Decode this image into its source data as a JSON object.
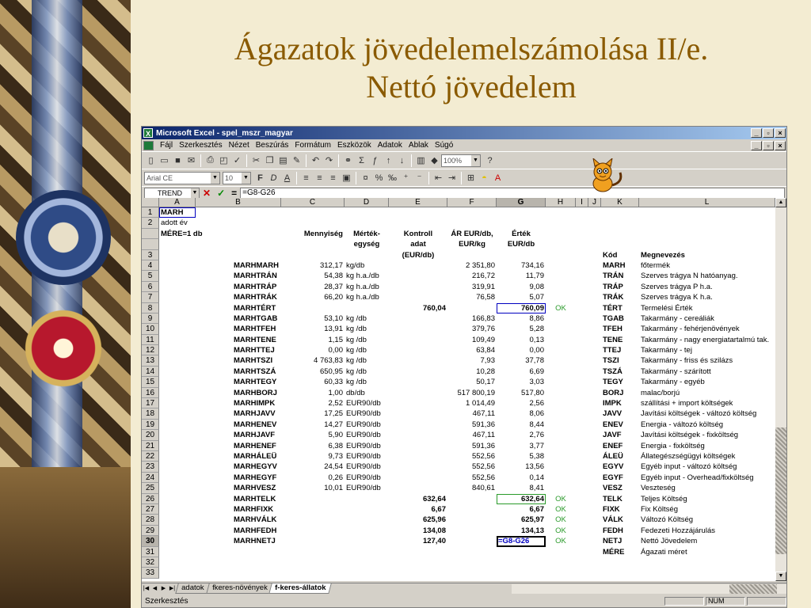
{
  "slide": {
    "title_line1": "Ágazatok jövedelemelszámolása II/e.",
    "title_line2": "Nettó jövedelem"
  },
  "window": {
    "title": "Microsoft Excel - spel_mszr_magyar",
    "controls": [
      "_",
      "▫",
      "×"
    ]
  },
  "menu": [
    "Fájl",
    "Szerkesztés",
    "Nézet",
    "Beszúrás",
    "Formátum",
    "Eszközök",
    "Adatok",
    "Ablak",
    "Súgó"
  ],
  "toolbar": {
    "zoom": "100%",
    "font_name": "Arial CE",
    "font_size": "10",
    "bold": "F",
    "italic": "D",
    "underline": "A"
  },
  "formula_bar": {
    "name_box": "TREND",
    "equals": "=",
    "formula": "=G8-G26"
  },
  "columns": [
    "A",
    "B",
    "C",
    "D",
    "E",
    "F",
    "G",
    "H",
    "I",
    "J",
    "K",
    "L"
  ],
  "rows": [
    {
      "n": "1",
      "a": "MARH",
      "b": "",
      "c": "",
      "d": "",
      "e": "",
      "f": "",
      "g": "",
      "h": "",
      "k": "",
      "l": ""
    },
    {
      "n": "2",
      "a": "adott év",
      "b": "",
      "c": "",
      "d": "",
      "e": "",
      "f": "",
      "g": "",
      "h": "",
      "k": "",
      "l": ""
    },
    {
      "n": "",
      "a": "MÉRE=1 db",
      "b": "",
      "c": "Mennyiség",
      "d": "Mérték-",
      "e": "Kontroll",
      "f": "ÁR EUR/db,",
      "g": "Érték",
      "h": "",
      "k": "",
      "l": ""
    },
    {
      "n": "",
      "a": "",
      "b": "",
      "c": "",
      "d": "egység",
      "e": "adat",
      "f": "EUR/kg",
      "g": "EUR/db",
      "h": "",
      "k": "",
      "l": ""
    },
    {
      "n": "3",
      "a": "",
      "b": "",
      "c": "",
      "d": "",
      "e": "(EUR/db)",
      "f": "",
      "g": "",
      "h": "",
      "k": "Kód",
      "l": "Megnevezés"
    },
    {
      "n": "4",
      "a": "",
      "b": "MARHMARH",
      "c": "312,17",
      "d": "kg/db",
      "e": "",
      "f": "2 351,80",
      "g": "734,16",
      "h": "",
      "k": "MARH",
      "l": "főtermék"
    },
    {
      "n": "5",
      "a": "",
      "b": "MARHTRÁN",
      "c": "54,38",
      "d": "kg h.a./db",
      "e": "",
      "f": "216,72",
      "g": "11,79",
      "h": "",
      "k": "TRÁN",
      "l": "Szerves trágya N hatóanyag."
    },
    {
      "n": "6",
      "a": "",
      "b": "MARHTRÁP",
      "c": "28,37",
      "d": "kg h.a./db",
      "e": "",
      "f": "319,91",
      "g": "9,08",
      "h": "",
      "k": "TRÁP",
      "l": "Szerves trágya P h.a."
    },
    {
      "n": "7",
      "a": "",
      "b": "MARHTRÁK",
      "c": "66,20",
      "d": "kg h.a./db",
      "e": "",
      "f": "76,58",
      "g": "5,07",
      "h": "",
      "k": "TRÁK",
      "l": "Szerves trágya K h.a."
    },
    {
      "n": "8",
      "a": "",
      "b": "MARHTÉRT",
      "c": "",
      "d": "",
      "e": "760,04",
      "f": "",
      "g": "760,09",
      "h": "OK",
      "k": "TÉRT",
      "l": "Termelési Érték"
    },
    {
      "n": "9",
      "a": "",
      "b": "MARHTGAB",
      "c": "53,10",
      "d": "kg /db",
      "e": "",
      "f": "166,83",
      "g": "8,86",
      "h": "",
      "k": "TGAB",
      "l": "Takarmány - cereáliák"
    },
    {
      "n": "10",
      "a": "",
      "b": "MARHTFEH",
      "c": "13,91",
      "d": "kg /db",
      "e": "",
      "f": "379,76",
      "g": "5,28",
      "h": "",
      "k": "TFEH",
      "l": "Takarmány - fehérjenövények"
    },
    {
      "n": "11",
      "a": "",
      "b": "MARHTENE",
      "c": "1,15",
      "d": "kg /db",
      "e": "",
      "f": "109,49",
      "g": "0,13",
      "h": "",
      "k": "TENE",
      "l": "Takarmány - nagy energiatartalmú tak."
    },
    {
      "n": "12",
      "a": "",
      "b": "MARHTTEJ",
      "c": "0,00",
      "d": "kg /db",
      "e": "",
      "f": "63,84",
      "g": "0,00",
      "h": "",
      "k": "TTEJ",
      "l": "Takarmány - tej"
    },
    {
      "n": "13",
      "a": "",
      "b": "MARHTSZI",
      "c": "4 763,83",
      "d": "kg /db",
      "e": "",
      "f": "7,93",
      "g": "37,78",
      "h": "",
      "k": "TSZI",
      "l": "Takarmány - friss és szilázs"
    },
    {
      "n": "14",
      "a": "",
      "b": "MARHTSZÁ",
      "c": "650,95",
      "d": "kg /db",
      "e": "",
      "f": "10,28",
      "g": "6,69",
      "h": "",
      "k": "TSZÁ",
      "l": "Takarmány - szárított"
    },
    {
      "n": "15",
      "a": "",
      "b": "MARHTEGY",
      "c": "60,33",
      "d": "kg /db",
      "e": "",
      "f": "50,17",
      "g": "3,03",
      "h": "",
      "k": "TEGY",
      "l": "Takarmány - egyéb"
    },
    {
      "n": "16",
      "a": "",
      "b": "MARHBORJ",
      "c": "1,00",
      "d": "db/db",
      "e": "",
      "f": "517 800,19",
      "g": "517,80",
      "h": "",
      "k": "BORJ",
      "l": "malac/borjú"
    },
    {
      "n": "17",
      "a": "",
      "b": "MARHIMPK",
      "c": "2,52",
      "d": "EUR90/db",
      "e": "",
      "f": "1 014,49",
      "g": "2,56",
      "h": "",
      "k": "IMPK",
      "l": "szállítási + import költségek"
    },
    {
      "n": "18",
      "a": "",
      "b": "MARHJAVV",
      "c": "17,25",
      "d": "EUR90/db",
      "e": "",
      "f": "467,11",
      "g": "8,06",
      "h": "",
      "k": "JAVV",
      "l": "Javítási költségek - változó költség"
    },
    {
      "n": "19",
      "a": "",
      "b": "MARHENEV",
      "c": "14,27",
      "d": "EUR90/db",
      "e": "",
      "f": "591,36",
      "g": "8,44",
      "h": "",
      "k": "ENEV",
      "l": "Energia - változó költség"
    },
    {
      "n": "20",
      "a": "",
      "b": "MARHJAVF",
      "c": "5,90",
      "d": "EUR90/db",
      "e": "",
      "f": "467,11",
      "g": "2,76",
      "h": "",
      "k": "JAVF",
      "l": "Javítási költségek - fixköltség"
    },
    {
      "n": "21",
      "a": "",
      "b": "MARHENEF",
      "c": "6,38",
      "d": "EUR90/db",
      "e": "",
      "f": "591,36",
      "g": "3,77",
      "h": "",
      "k": "ENEF",
      "l": "Energia - fixköltség"
    },
    {
      "n": "22",
      "a": "",
      "b": "MARHÁLEÜ",
      "c": "9,73",
      "d": "EUR90/db",
      "e": "",
      "f": "552,56",
      "g": "5,38",
      "h": "",
      "k": "ÁLEÜ",
      "l": "Állategészségügyi költségek"
    },
    {
      "n": "23",
      "a": "",
      "b": "MARHEGYV",
      "c": "24,54",
      "d": "EUR90/db",
      "e": "",
      "f": "552,56",
      "g": "13,56",
      "h": "",
      "k": "EGYV",
      "l": "Egyéb input - változó költség"
    },
    {
      "n": "24",
      "a": "",
      "b": "MARHEGYF",
      "c": "0,26",
      "d": "EUR90/db",
      "e": "",
      "f": "552,56",
      "g": "0,14",
      "h": "",
      "k": "EGYF",
      "l": "Egyéb input - Overhead/fixköltség"
    },
    {
      "n": "25",
      "a": "",
      "b": "MARHVESZ",
      "c": "10,01",
      "d": "EUR90/db",
      "e": "",
      "f": "840,61",
      "g": "8,41",
      "h": "",
      "k": "VESZ",
      "l": "Veszteség"
    },
    {
      "n": "26",
      "a": "",
      "b": "MARHTELK",
      "c": "",
      "d": "",
      "e": "632,64",
      "f": "",
      "g": "632,64",
      "h": "OK",
      "k": "TELK",
      "l": "Teljes Költség"
    },
    {
      "n": "27",
      "a": "",
      "b": "MARHFIXK",
      "c": "",
      "d": "",
      "e": "6,67",
      "f": "",
      "g": "6,67",
      "h": "OK",
      "k": "FIXK",
      "l": "Fix Költség"
    },
    {
      "n": "28",
      "a": "",
      "b": "MARHVÁLK",
      "c": "",
      "d": "",
      "e": "625,96",
      "f": "",
      "g": "625,97",
      "h": "OK",
      "k": "VÁLK",
      "l": "Változó Költség"
    },
    {
      "n": "29",
      "a": "",
      "b": "MARHFEDH",
      "c": "",
      "d": "",
      "e": "134,08",
      "f": "",
      "g": "134,13",
      "h": "OK",
      "k": "FEDH",
      "l": "Fedezeti Hozzájárulás"
    },
    {
      "n": "30",
      "a": "",
      "b": "MARHNETJ",
      "c": "",
      "d": "",
      "e": "127,40",
      "f": "",
      "g": "=G8-G26",
      "h": "OK",
      "k": "NETJ",
      "l": "Nettó Jövedelem"
    },
    {
      "n": "31",
      "a": "",
      "b": "",
      "c": "",
      "d": "",
      "e": "",
      "f": "",
      "g": "",
      "h": "",
      "k": "MÉRE",
      "l": "Ágazati méret"
    },
    {
      "n": "32",
      "a": "",
      "b": "",
      "c": "",
      "d": "",
      "e": "",
      "f": "",
      "g": "",
      "h": "",
      "k": "",
      "l": ""
    },
    {
      "n": "33",
      "a": "",
      "b": "",
      "c": "",
      "d": "",
      "e": "",
      "f": "",
      "g": "",
      "h": "",
      "k": "",
      "l": ""
    }
  ],
  "sheet_tabs": [
    "adatok",
    "fkeres-növények",
    "f-keres-állatok"
  ],
  "status": {
    "left": "Szerkesztés",
    "num": "NUM"
  }
}
